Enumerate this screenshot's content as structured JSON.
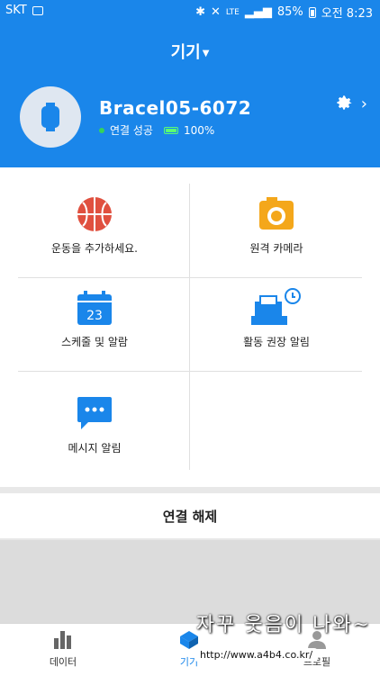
{
  "status_bar": {
    "carrier": "SKT",
    "network": "LTE",
    "battery": "85%",
    "time": "오전 8:23"
  },
  "header": {
    "title": "기기",
    "device_name": "Bracel05-6072",
    "connection": "연결 성공",
    "battery_percent": "100%"
  },
  "menu": {
    "add_exercise": "운동을 추가하세요.",
    "remote_camera": "원격 카메라",
    "schedule_alarm": "스케줄 및 알람",
    "calendar_day": "23",
    "activity_alert": "활동 권장 알림",
    "message_alert": "메시지 알림"
  },
  "actions": {
    "disconnect": "연결 해제"
  },
  "bottom_nav": {
    "data": "데이터",
    "device": "기기",
    "profile": "프로필"
  },
  "watermark": {
    "text": "자꾸 웃음이 나와~",
    "url": "http://www.a4b4.co.kr/"
  },
  "colors": {
    "primary": "#1a86ea",
    "connected": "#35d35a",
    "battery": "#5aff73"
  }
}
